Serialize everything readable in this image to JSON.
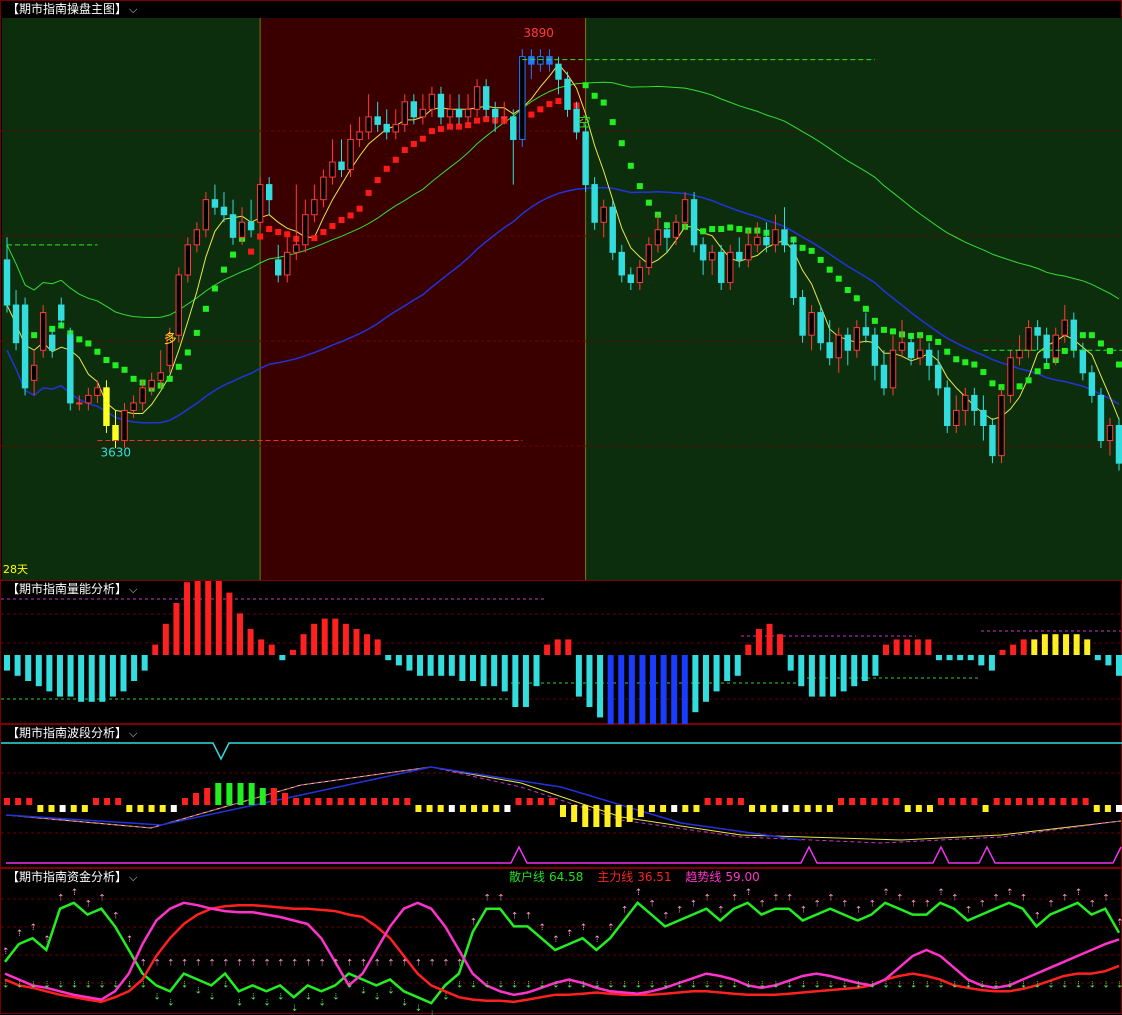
{
  "panels": {
    "main": {
      "title": "【期市指南操盘主图】",
      "days_label": "28天"
    },
    "volume": {
      "title": "【期市指南量能分析】"
    },
    "wave": {
      "title": "【期市指南波段分析】"
    },
    "fund": {
      "title": "【期市指南资金分析】",
      "legend": [
        {
          "name": "散户线",
          "value": "64.58",
          "color": "#22dd22"
        },
        {
          "name": "主力线",
          "value": "36.51",
          "color": "#ff2222"
        },
        {
          "name": "趋势线",
          "value": "59.00",
          "color": "#ff33cc"
        }
      ]
    }
  },
  "icons": {
    "dropdown": "chevron-down-icon"
  },
  "chart_data": [
    {
      "type": "candlestick",
      "panel": "main",
      "annotations": {
        "high": "3890",
        "low": "3630",
        "buy_signal": "多",
        "sell_signal": "空"
      },
      "ylim": [
        3550,
        3910
      ],
      "candles": [
        [
          3750,
          3720,
          3765,
          3715
        ],
        [
          3720,
          3695,
          3730,
          3690
        ],
        [
          3720,
          3665,
          3725,
          3660
        ],
        [
          3670,
          3680,
          3690,
          3660
        ],
        [
          3690,
          3715,
          3720,
          3685
        ],
        [
          3700,
          3690,
          3705,
          3685
        ],
        [
          3720,
          3710,
          3725,
          3705
        ],
        [
          3700,
          3655,
          3705,
          3650
        ],
        [
          3655,
          3655,
          3660,
          3650
        ],
        [
          3655,
          3660,
          3665,
          3650
        ],
        [
          3660,
          3665,
          3670,
          3655
        ],
        [
          3665,
          3640,
          3670,
          3635
        ],
        [
          3640,
          3630,
          3650,
          3625
        ],
        [
          3630,
          3650,
          3655,
          3625
        ],
        [
          3650,
          3655,
          3660,
          3645
        ],
        [
          3655,
          3665,
          3670,
          3650
        ],
        [
          3665,
          3670,
          3675,
          3660
        ],
        [
          3670,
          3675,
          3690,
          3665
        ],
        [
          3680,
          3700,
          3705,
          3675
        ],
        [
          3700,
          3740,
          3745,
          3695
        ],
        [
          3740,
          3760,
          3765,
          3735
        ],
        [
          3760,
          3770,
          3775,
          3755
        ],
        [
          3770,
          3790,
          3795,
          3765
        ],
        [
          3790,
          3785,
          3800,
          3780
        ],
        [
          3785,
          3780,
          3795,
          3775
        ],
        [
          3780,
          3765,
          3790,
          3760
        ],
        [
          3765,
          3775,
          3785,
          3760
        ],
        [
          3775,
          3770,
          3790,
          3765
        ],
        [
          3775,
          3800,
          3805,
          3770
        ],
        [
          3800,
          3790,
          3805,
          3780
        ],
        [
          3750,
          3740,
          3760,
          3735
        ],
        [
          3740,
          3755,
          3765,
          3735
        ],
        [
          3755,
          3760,
          3800,
          3750
        ],
        [
          3760,
          3780,
          3790,
          3755
        ],
        [
          3780,
          3790,
          3800,
          3775
        ],
        [
          3790,
          3805,
          3810,
          3785
        ],
        [
          3805,
          3815,
          3830,
          3800
        ],
        [
          3815,
          3810,
          3830,
          3805
        ],
        [
          3810,
          3830,
          3840,
          3805
        ],
        [
          3830,
          3835,
          3845,
          3825
        ],
        [
          3835,
          3845,
          3860,
          3830
        ],
        [
          3845,
          3840,
          3855,
          3835
        ],
        [
          3840,
          3835,
          3850,
          3830
        ],
        [
          3835,
          3840,
          3850,
          3830
        ],
        [
          3840,
          3855,
          3860,
          3835
        ],
        [
          3855,
          3845,
          3860,
          3840
        ],
        [
          3845,
          3850,
          3860,
          3840
        ],
        [
          3850,
          3860,
          3865,
          3845
        ],
        [
          3860,
          3845,
          3865,
          3840
        ],
        [
          3845,
          3850,
          3860,
          3840
        ],
        [
          3850,
          3845,
          3860,
          3840
        ],
        [
          3845,
          3850,
          3860,
          3840
        ],
        [
          3850,
          3865,
          3870,
          3845
        ],
        [
          3865,
          3850,
          3870,
          3845
        ],
        [
          3850,
          3845,
          3855,
          3835
        ],
        [
          3845,
          3845,
          3855,
          3840
        ],
        [
          3845,
          3830,
          3850,
          3800
        ],
        [
          3830,
          3885,
          3890,
          3825
        ],
        [
          3885,
          3880,
          3890,
          3870
        ],
        [
          3880,
          3885,
          3890,
          3875
        ],
        [
          3885,
          3880,
          3890,
          3875
        ],
        [
          3880,
          3870,
          3885,
          3860
        ],
        [
          3870,
          3850,
          3875,
          3845
        ],
        [
          3850,
          3835,
          3855,
          3830
        ],
        [
          3835,
          3800,
          3840,
          3795
        ],
        [
          3800,
          3775,
          3805,
          3770
        ],
        [
          3775,
          3785,
          3790,
          3765
        ],
        [
          3785,
          3755,
          3790,
          3750
        ],
        [
          3755,
          3740,
          3760,
          3735
        ],
        [
          3740,
          3735,
          3745,
          3730
        ],
        [
          3735,
          3745,
          3750,
          3730
        ],
        [
          3745,
          3760,
          3765,
          3740
        ],
        [
          3760,
          3770,
          3780,
          3755
        ],
        [
          3770,
          3765,
          3775,
          3755
        ],
        [
          3765,
          3775,
          3780,
          3760
        ],
        [
          3775,
          3790,
          3795,
          3770
        ],
        [
          3790,
          3760,
          3795,
          3755
        ],
        [
          3760,
          3750,
          3765,
          3740
        ],
        [
          3750,
          3755,
          3760,
          3740
        ],
        [
          3755,
          3735,
          3760,
          3730
        ],
        [
          3735,
          3755,
          3760,
          3730
        ],
        [
          3755,
          3750,
          3765,
          3745
        ],
        [
          3750,
          3760,
          3770,
          3745
        ],
        [
          3760,
          3765,
          3775,
          3755
        ],
        [
          3765,
          3760,
          3775,
          3755
        ],
        [
          3760,
          3770,
          3780,
          3755
        ],
        [
          3770,
          3760,
          3785,
          3755
        ],
        [
          3760,
          3725,
          3765,
          3720
        ],
        [
          3725,
          3700,
          3730,
          3695
        ],
        [
          3700,
          3715,
          3720,
          3690
        ],
        [
          3715,
          3695,
          3720,
          3690
        ],
        [
          3695,
          3685,
          3710,
          3680
        ],
        [
          3685,
          3700,
          3705,
          3675
        ],
        [
          3700,
          3690,
          3705,
          3680
        ],
        [
          3690,
          3705,
          3710,
          3685
        ],
        [
          3705,
          3700,
          3715,
          3695
        ],
        [
          3700,
          3680,
          3705,
          3670
        ],
        [
          3680,
          3665,
          3690,
          3660
        ],
        [
          3665,
          3690,
          3700,
          3660
        ],
        [
          3690,
          3695,
          3710,
          3685
        ],
        [
          3695,
          3685,
          3700,
          3680
        ],
        [
          3685,
          3690,
          3700,
          3680
        ],
        [
          3690,
          3680,
          3695,
          3670
        ],
        [
          3680,
          3665,
          3690,
          3660
        ],
        [
          3665,
          3640,
          3670,
          3635
        ],
        [
          3640,
          3650,
          3660,
          3635
        ],
        [
          3650,
          3660,
          3665,
          3640
        ],
        [
          3660,
          3650,
          3665,
          3640
        ],
        [
          3650,
          3640,
          3660,
          3630
        ],
        [
          3640,
          3620,
          3645,
          3615
        ],
        [
          3620,
          3660,
          3665,
          3615
        ],
        [
          3660,
          3685,
          3690,
          3655
        ],
        [
          3685,
          3690,
          3700,
          3680
        ],
        [
          3690,
          3705,
          3710,
          3685
        ],
        [
          3705,
          3700,
          3710,
          3690
        ],
        [
          3700,
          3685,
          3705,
          3680
        ],
        [
          3685,
          3700,
          3705,
          3680
        ],
        [
          3700,
          3710,
          3720,
          3695
        ],
        [
          3710,
          3690,
          3715,
          3685
        ],
        [
          3690,
          3675,
          3695,
          3670
        ],
        [
          3675,
          3660,
          3680,
          3655
        ],
        [
          3660,
          3630,
          3665,
          3625
        ],
        [
          3630,
          3640,
          3645,
          3620
        ],
        [
          3640,
          3615,
          3645,
          3610
        ]
      ]
    },
    {
      "type": "bar",
      "panel": "volume",
      "values": [
        -3,
        -4,
        -5,
        -6,
        -7,
        -8,
        -8,
        -9,
        -9,
        -9,
        -8,
        -7,
        -5,
        -3,
        2,
        6,
        10,
        14,
        16,
        16,
        15,
        12,
        8,
        5,
        3,
        2,
        -1,
        1,
        4,
        6,
        7,
        7,
        6,
        5,
        4,
        3,
        -1,
        -2,
        -3,
        -4,
        -4,
        -4,
        -4,
        -5,
        -5,
        -6,
        -6,
        -7,
        -10,
        -10,
        -6,
        2,
        3,
        3,
        -8,
        -10,
        -12,
        -14,
        -18,
        -20,
        -24,
        -24,
        -22,
        -18,
        -14,
        -11,
        -9,
        -7,
        -5,
        -4,
        2,
        5,
        6,
        4,
        -3,
        -6,
        -8,
        -8,
        -8,
        -7,
        -6,
        -5,
        -4,
        2,
        3,
        3,
        3,
        3,
        -1,
        -1,
        -1,
        -1,
        -2,
        -3,
        1,
        2,
        3,
        3,
        4,
        4,
        4,
        4,
        3,
        -1,
        -2,
        -4
      ]
    },
    {
      "type": "bar",
      "panel": "wave",
      "values": [
        1,
        1,
        1,
        -1,
        -1,
        -1,
        -1,
        -1,
        1,
        1,
        1,
        -1,
        -1,
        -1,
        -1,
        -1,
        1,
        2,
        3,
        4,
        4,
        4,
        4,
        3,
        3,
        2,
        1,
        1,
        1,
        1,
        1,
        1,
        1,
        1,
        1,
        1,
        1,
        -1,
        -1,
        -1,
        -1,
        -1,
        -1,
        -1,
        -1,
        -1,
        1,
        1,
        1,
        1,
        -2,
        -3,
        -4,
        -4,
        -4,
        -4,
        -3,
        -2,
        -1,
        -1,
        -1,
        -1,
        -1,
        1,
        1,
        1,
        1,
        -1,
        -1,
        -1,
        -1,
        -1,
        -1,
        -1,
        -1,
        1,
        1,
        1,
        1,
        1,
        1,
        -1,
        -1,
        -1,
        1,
        1,
        1,
        1,
        -1,
        1,
        1,
        1,
        1,
        1,
        1,
        1,
        1,
        1,
        -1,
        -1,
        -1
      ]
    },
    {
      "type": "line",
      "panel": "fund",
      "series": [
        {
          "name": "散户线",
          "values": [
            40,
            55,
            60,
            50,
            85,
            90,
            80,
            85,
            70,
            50,
            30,
            20,
            15,
            30,
            25,
            20,
            30,
            15,
            20,
            15,
            20,
            10,
            20,
            15,
            20,
            30,
            25,
            20,
            25,
            15,
            10,
            5,
            20,
            30,
            65,
            85,
            85,
            70,
            70,
            60,
            50,
            55,
            60,
            50,
            60,
            75,
            90,
            80,
            70,
            75,
            80,
            85,
            75,
            85,
            90,
            80,
            85,
            85,
            75,
            80,
            85,
            80,
            75,
            80,
            90,
            85,
            80,
            80,
            90,
            85,
            75,
            80,
            85,
            90,
            85,
            70,
            80,
            85,
            90,
            80,
            85,
            64.58
          ]
        },
        {
          "name": "主力线",
          "values": [
            25,
            20,
            18,
            15,
            12,
            10,
            8,
            6,
            10,
            15,
            25,
            45,
            60,
            72,
            80,
            85,
            87,
            88,
            88,
            87,
            86,
            85,
            85,
            84,
            83,
            80,
            78,
            70,
            60,
            45,
            30,
            20,
            15,
            10,
            8,
            7,
            7,
            6,
            8,
            10,
            12,
            12,
            13,
            14,
            13,
            12,
            12,
            12,
            13,
            14,
            15,
            15,
            14,
            13,
            12,
            12,
            12,
            13,
            14,
            15,
            16,
            17,
            18,
            20,
            25,
            28,
            30,
            28,
            25,
            20,
            18,
            16,
            15,
            15,
            17,
            20,
            24,
            28,
            30,
            30,
            32,
            36.51
          ]
        },
        {
          "name": "趋势线",
          "values": [
            30,
            25,
            20,
            18,
            15,
            12,
            10,
            8,
            15,
            30,
            55,
            75,
            85,
            90,
            88,
            85,
            83,
            82,
            82,
            80,
            78,
            75,
            72,
            60,
            40,
            20,
            30,
            50,
            70,
            85,
            90,
            85,
            70,
            50,
            30,
            20,
            15,
            12,
            14,
            18,
            22,
            25,
            22,
            18,
            15,
            14,
            13,
            15,
            18,
            22,
            26,
            30,
            28,
            25,
            20,
            18,
            20,
            24,
            28,
            30,
            28,
            25,
            22,
            20,
            25,
            35,
            45,
            50,
            45,
            35,
            25,
            20,
            18,
            20,
            25,
            30,
            35,
            40,
            45,
            50,
            55,
            59.0
          ]
        }
      ]
    }
  ]
}
